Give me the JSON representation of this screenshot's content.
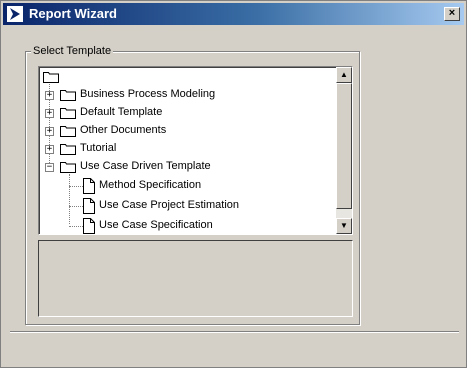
{
  "window": {
    "title": "Report Wizard",
    "close_label": "×"
  },
  "group": {
    "label": "Select Template"
  },
  "tree": {
    "items": [
      {
        "label": "Business Process Modeling",
        "type": "folder",
        "state": "collapsed"
      },
      {
        "label": "Default Template",
        "type": "folder",
        "state": "collapsed"
      },
      {
        "label": "Other Documents",
        "type": "folder",
        "state": "collapsed"
      },
      {
        "label": "Tutorial",
        "type": "folder",
        "state": "collapsed"
      },
      {
        "label": "Use Case Driven Template",
        "type": "folder",
        "state": "expanded",
        "children": [
          {
            "label": "Method Specification",
            "type": "document"
          },
          {
            "label": "Use Case Project Estimation",
            "type": "document"
          },
          {
            "label": "Use Case Specification",
            "type": "document"
          }
        ]
      }
    ]
  },
  "icons": [
    "app-icon",
    "close-icon",
    "folder-icon",
    "document-icon",
    "expand-icon",
    "collapse-icon",
    "scroll-up-icon",
    "scroll-down-icon"
  ]
}
